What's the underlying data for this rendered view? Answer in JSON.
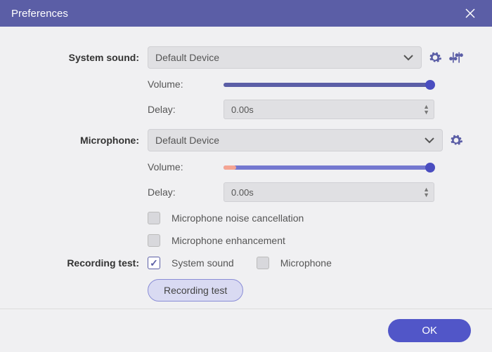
{
  "title": "Preferences",
  "system_sound": {
    "label": "System sound:",
    "device": "Default Device",
    "volume_label": "Volume:",
    "volume_pct": 98,
    "delay_label": "Delay:",
    "delay_value": "0.00s"
  },
  "microphone": {
    "label": "Microphone:",
    "device": "Default Device",
    "volume_label": "Volume:",
    "volume_level_pct": 6,
    "volume_pos_pct": 98,
    "delay_label": "Delay:",
    "delay_value": "0.00s",
    "noise_cancel_label": "Microphone noise cancellation",
    "noise_cancel_checked": false,
    "enhance_label": "Microphone enhancement",
    "enhance_checked": false
  },
  "recording_test": {
    "label": "Recording test:",
    "system_label": "System sound",
    "system_checked": true,
    "mic_label": "Microphone",
    "mic_checked": false,
    "button_label": "Recording test"
  },
  "ok_label": "OK"
}
